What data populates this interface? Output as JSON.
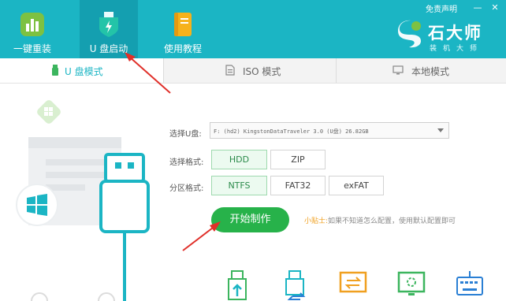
{
  "header": {
    "nav": [
      {
        "label": "一键重装",
        "icon": "bar-chart-icon"
      },
      {
        "label": "U 盘启动",
        "icon": "usb-shield-icon"
      },
      {
        "label": "使用教程",
        "icon": "book-icon"
      }
    ],
    "disclaimer": "免责声明",
    "minimize": "—",
    "close": "✕",
    "logo": {
      "title": "石大师",
      "subtitle": "装机大师"
    }
  },
  "tabs": [
    {
      "label": "U 盘模式",
      "icon": "usb-stick-icon",
      "active": true
    },
    {
      "label": "ISO 模式",
      "icon": "iso-file-icon",
      "active": false
    },
    {
      "label": "本地模式",
      "icon": "monitor-icon",
      "active": false
    }
  ],
  "form": {
    "usb_label": "选择U盘:",
    "usb_value": "F: (hd2) KingstonDataTraveler 3.0 (U盘) 26.82GB",
    "format_label": "选择格式:",
    "formats": [
      {
        "label": "HDD",
        "selected": true
      },
      {
        "label": "ZIP",
        "selected": false
      }
    ],
    "partition_label": "分区格式:",
    "partitions": [
      {
        "label": "NTFS",
        "selected": true
      },
      {
        "label": "FAT32",
        "selected": false
      },
      {
        "label": "exFAT",
        "selected": false
      }
    ],
    "start_button": "开始制作",
    "tip_key": "小贴士:",
    "tip_text": "如果不知道怎么配置，使用默认配置即可"
  },
  "tools": [
    "usb-upload-icon",
    "usb-transfer-icon",
    "screen-swap-icon",
    "monitor-loading-icon",
    "keyboard-icon"
  ],
  "colors": {
    "brand": "#1bb5c4",
    "accent_green": "#27b24a",
    "annotation_red": "#e0302a",
    "tip_orange": "#f0a020"
  }
}
